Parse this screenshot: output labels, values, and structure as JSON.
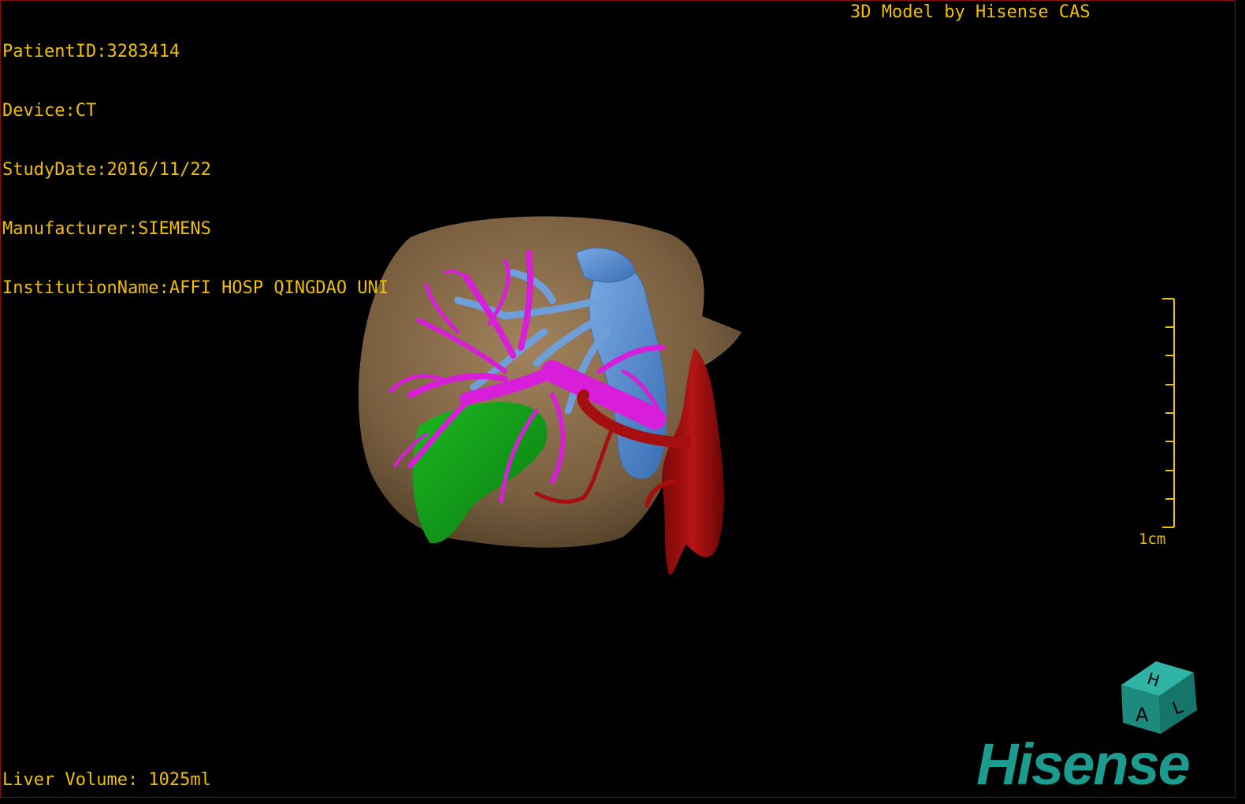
{
  "dicom_info": {
    "patient_id": "PatientID:3283414",
    "device": "Device:CT",
    "study_date": "StudyDate:2016/11/22",
    "manufacturer": "Manufacturer:SIEMENS",
    "institution": "InstitutionName:AFFI HOSP QINGDAO UNI"
  },
  "credit": "3D Model by Hisense CAS",
  "liver_volume": "Liver Volume: 1025ml",
  "scale_bar": {
    "label": "1cm"
  },
  "orientation_cube": {
    "faces": [
      "H",
      "A",
      "L"
    ]
  },
  "brand": "Hisense",
  "colors": {
    "overlay_text": "#f0c000",
    "liver": "#c49a6c",
    "portal_vein": "#d81ed8",
    "hepatic_vein": "#5b8fd0",
    "artery": "#a50f0f",
    "gallbladder_region": "#0e9a14",
    "brand": "#1c9c8e"
  }
}
